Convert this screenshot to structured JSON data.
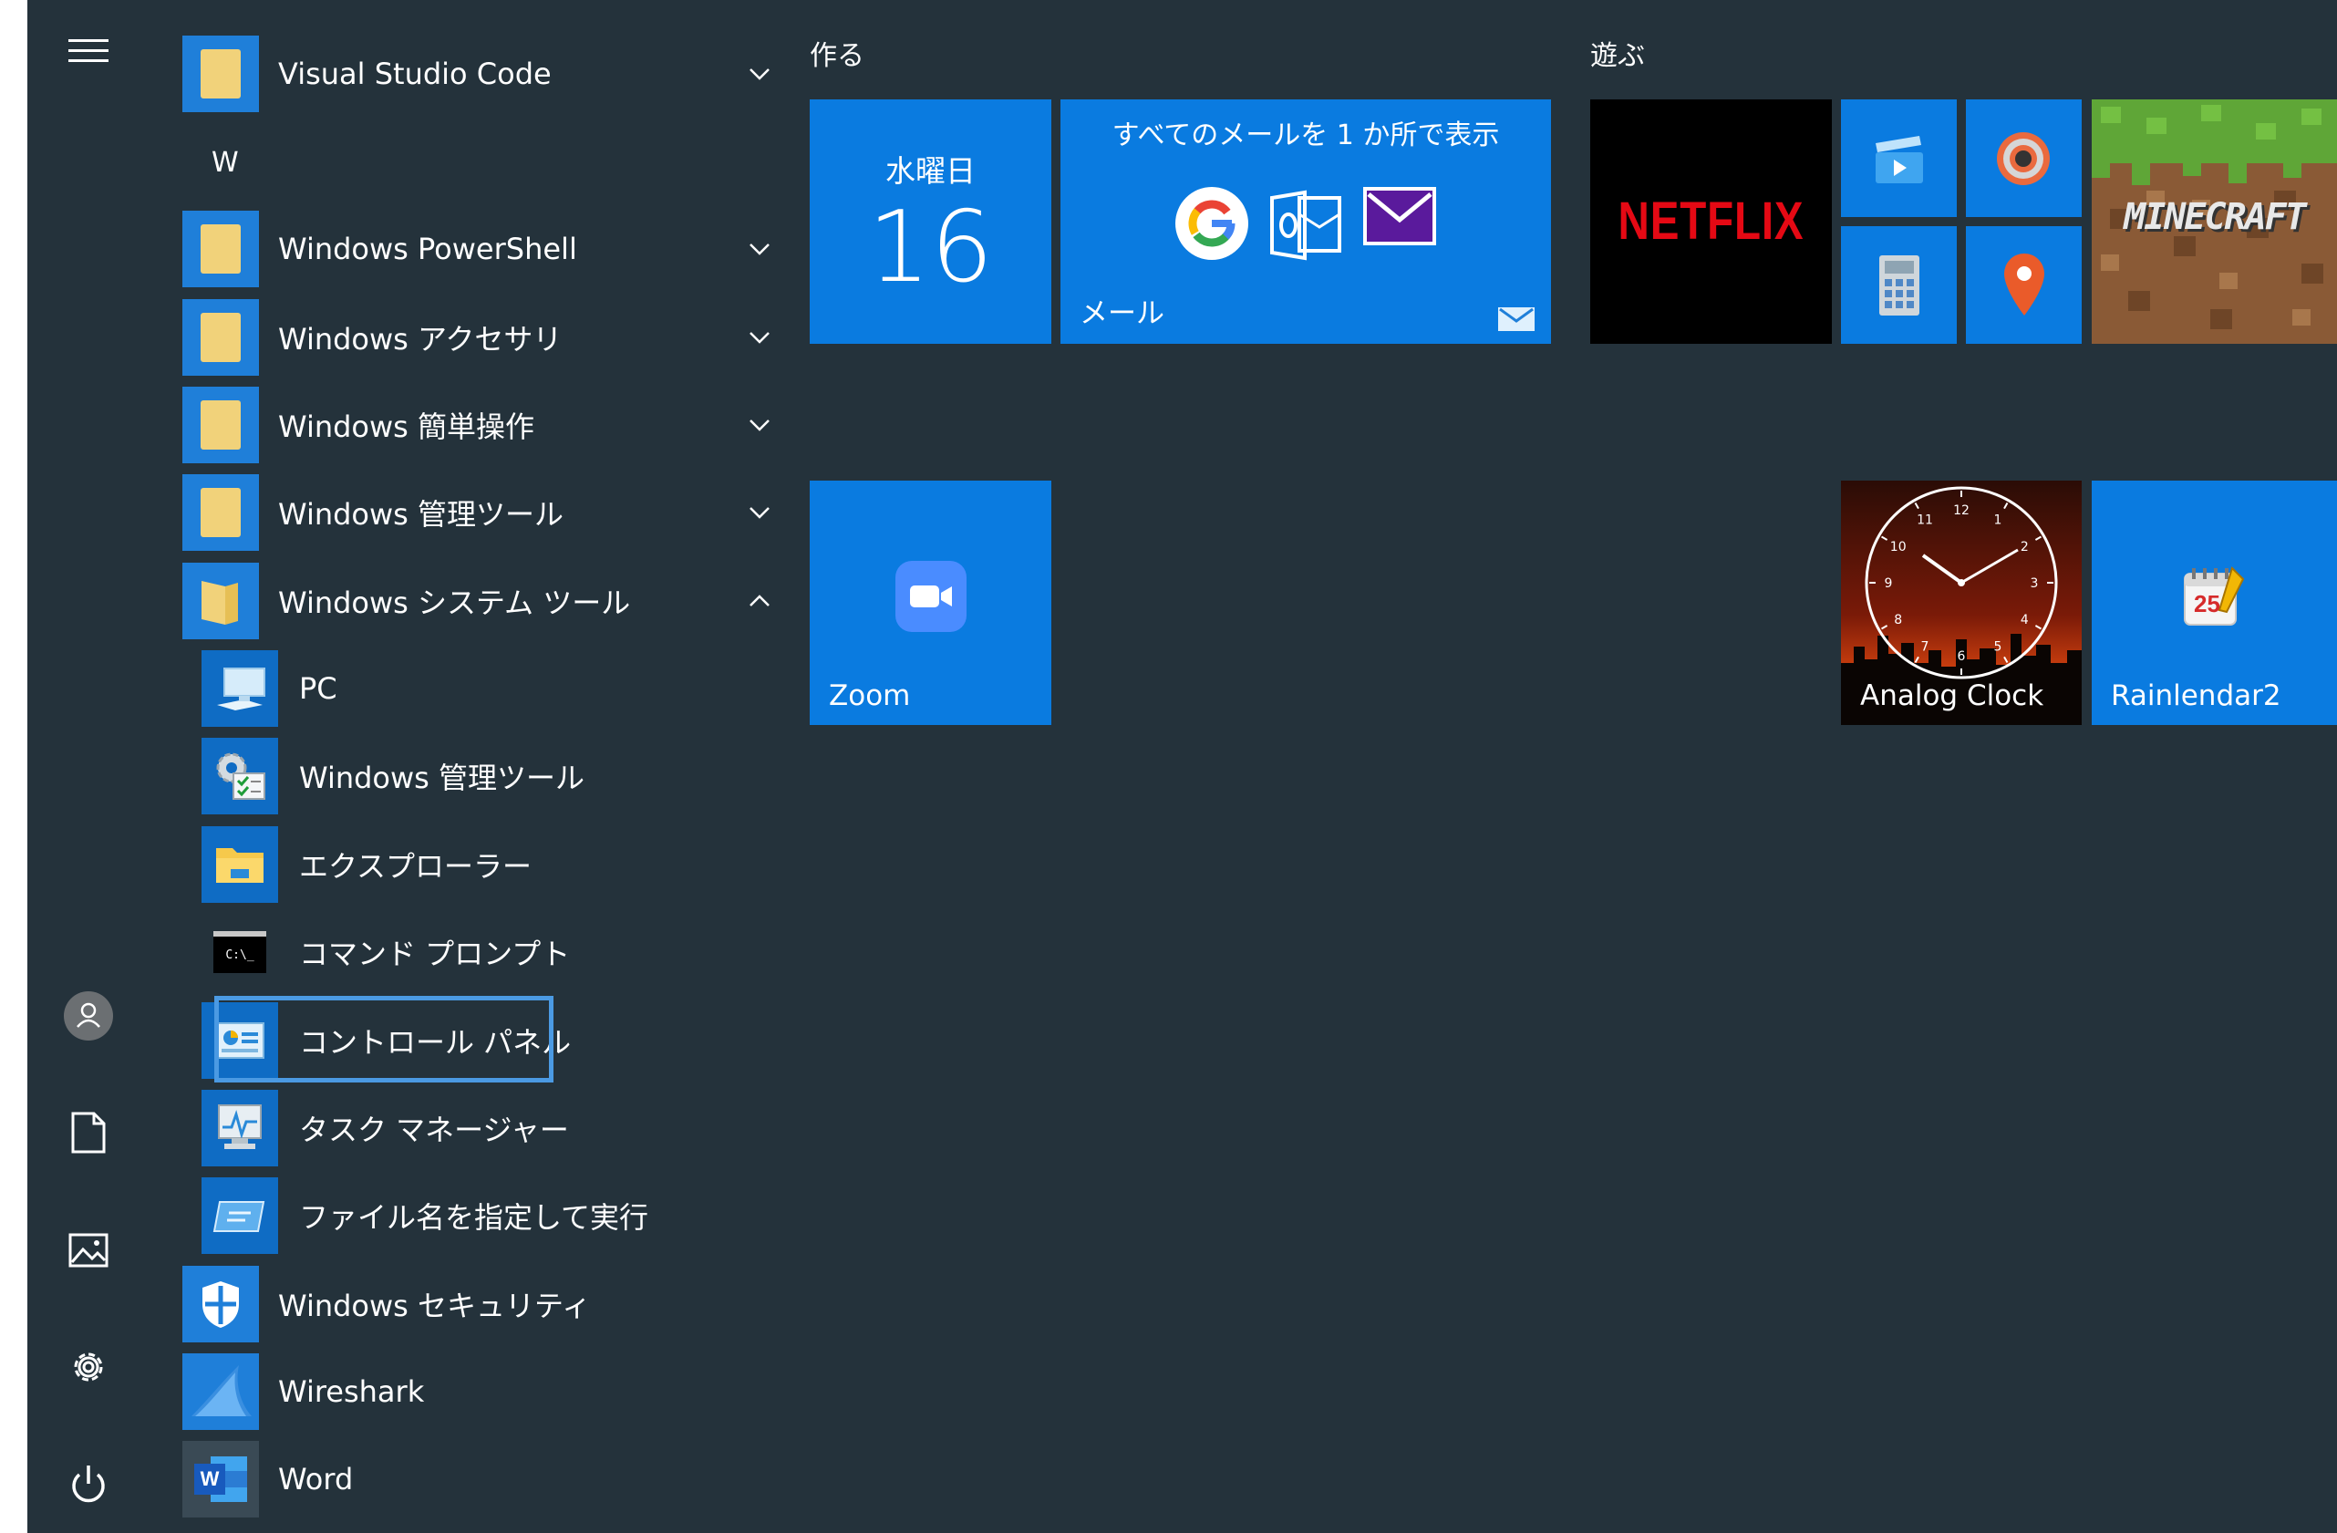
{
  "rail": {
    "icons": [
      "hamburger-menu-icon",
      "user-avatar-icon",
      "documents-icon",
      "pictures-icon",
      "settings-gear-icon",
      "power-icon"
    ]
  },
  "apps": {
    "letter_w": "W",
    "items": [
      {
        "label": "Visual Studio Code",
        "icon": "folder-icon",
        "expander": "chevron-down"
      },
      {
        "label": "Windows PowerShell",
        "icon": "folder-icon",
        "expander": "chevron-down"
      },
      {
        "label": "Windows アクセサリ",
        "icon": "folder-icon",
        "expander": "chevron-down"
      },
      {
        "label": "Windows 簡単操作",
        "icon": "folder-icon",
        "expander": "chevron-down"
      },
      {
        "label": "Windows 管理ツール",
        "icon": "folder-icon",
        "expander": "chevron-down"
      },
      {
        "label": "Windows システム ツール",
        "icon": "folder-open-icon",
        "expander": "chevron-up"
      },
      {
        "label": "PC",
        "icon": "pc-icon"
      },
      {
        "label": "Windows 管理ツール",
        "icon": "admin-tools-icon"
      },
      {
        "label": "エクスプローラー",
        "icon": "file-explorer-icon"
      },
      {
        "label": "コマンド プロンプト",
        "icon": "command-prompt-icon",
        "icon_text": "C:\\_"
      },
      {
        "label": "コントロール パネル",
        "icon": "control-panel-icon",
        "focused": true
      },
      {
        "label": "タスク マネージャー",
        "icon": "task-manager-icon"
      },
      {
        "label": "ファイル名を指定して実行",
        "icon": "run-icon"
      },
      {
        "label": "Windows セキュリティ",
        "icon": "shield-icon"
      },
      {
        "label": "Wireshark",
        "icon": "wireshark-fin-icon"
      },
      {
        "label": "Word",
        "icon": "word-icon",
        "icon_text": "W"
      }
    ]
  },
  "groups": {
    "create": "作る",
    "play": "遊ぶ"
  },
  "tiles": {
    "calendar": {
      "weekday": "水曜日",
      "day": "16"
    },
    "mail": {
      "headline": "すべてのメールを 1 か所で表示",
      "label": "メール"
    },
    "netflix": {
      "logo_text": "NETFLIX"
    },
    "minecraft": {
      "logo_text": "MINECRAFT"
    },
    "zoom": {
      "label": "Zoom"
    },
    "analog_clock": {
      "label": "Analog Clock",
      "numbers": [
        "12",
        "1",
        "2",
        "3",
        "4",
        "5",
        "6",
        "7",
        "8",
        "9",
        "10",
        "11"
      ]
    },
    "rainlendar": {
      "label": "Rainlendar2",
      "icon_text": "25"
    }
  },
  "colors": {
    "background": "#24323b",
    "tile_blue": "#0a7be0",
    "focus_border": "#4b9ae3",
    "netflix_red": "#e50914"
  }
}
